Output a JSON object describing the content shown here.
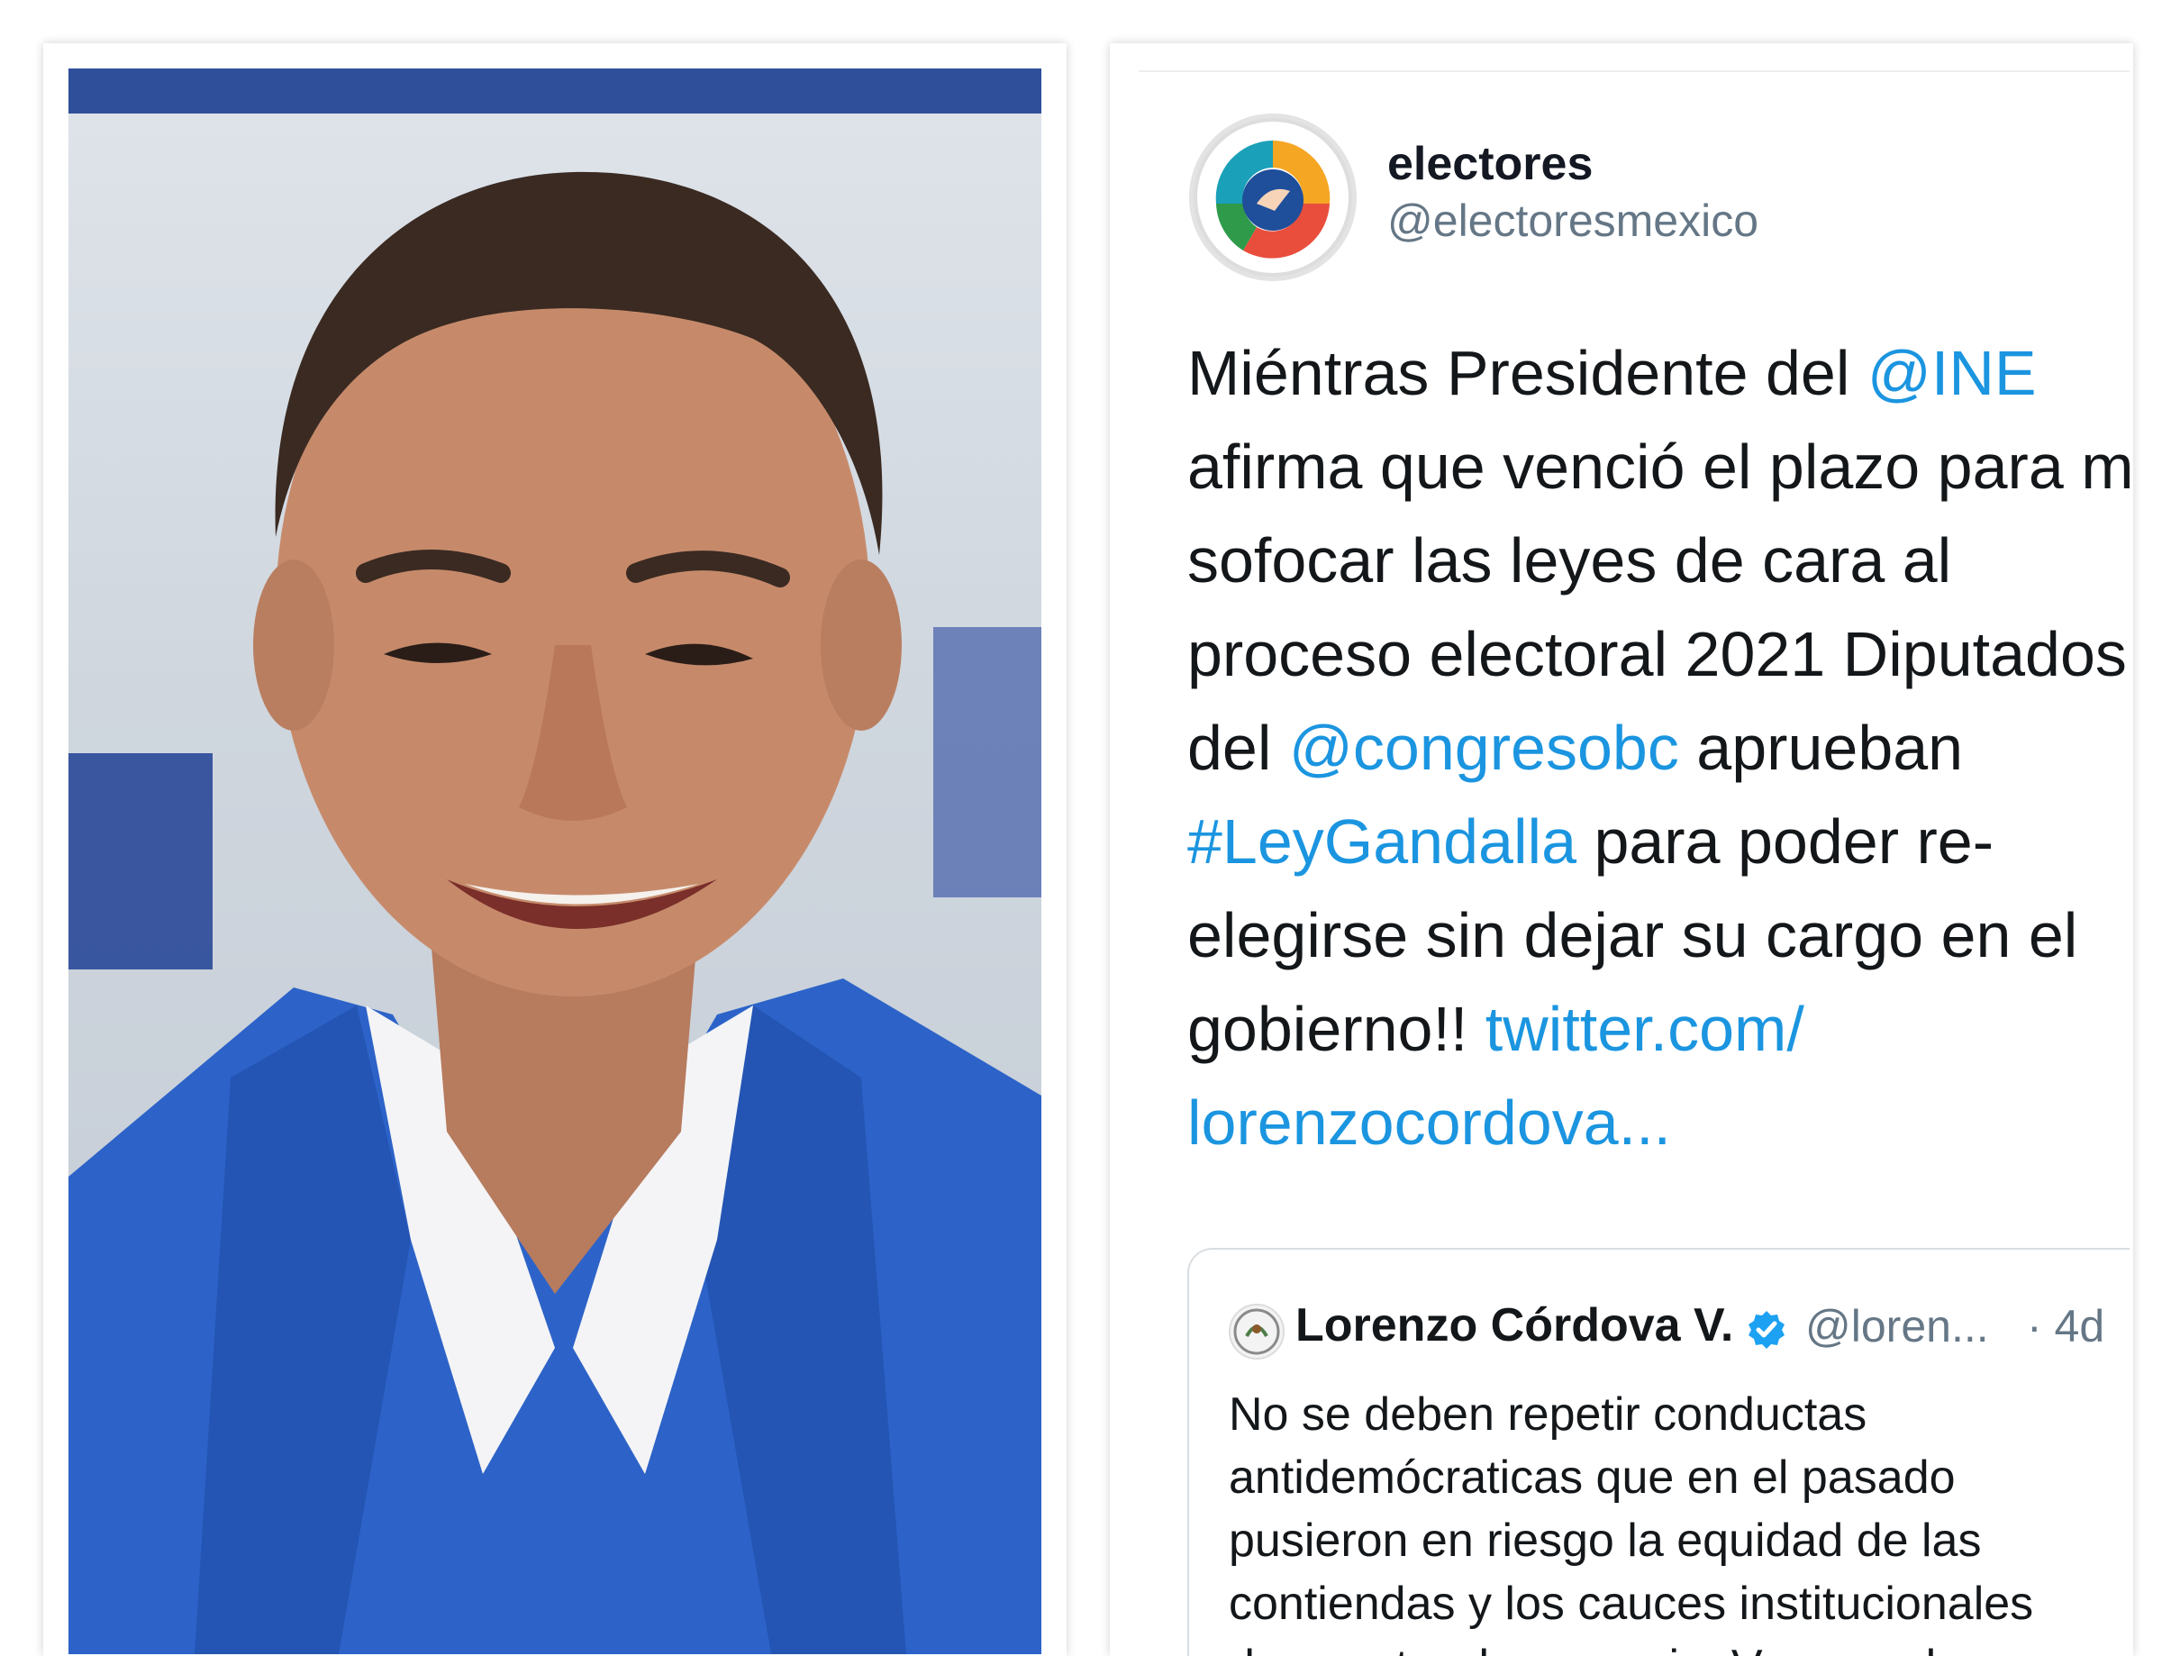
{
  "photo": {
    "description_icon": "portrait-photo"
  },
  "tweet": {
    "display_name": "electores",
    "handle": "@electoresmexico",
    "body": {
      "line1_a": "Miéntras Presidente del ",
      "line1_mention": "@INE",
      "line2": "afirma que venció el plazo para m",
      "line3": "sofocar las leyes de cara al",
      "line4": "proceso electoral 2021 Diputados",
      "line5_a": "del ",
      "line5_mention": "@congresobc",
      "line5_b": " aprueban",
      "line6_hashtag": "#LeyGandalla",
      "line6_b": " para poder re-",
      "line7": "elegirse sin dejar su cargo en el",
      "line8_a": "gobierno!!  ",
      "line8_link": "twitter.com/",
      "line9_link": "lorenzocordova..."
    },
    "colors": {
      "link": "#1b95e0",
      "text": "#14171a",
      "muted": "#657786"
    }
  },
  "quoted_tweet": {
    "display_name": "Lorenzo Córdova V.",
    "handle": "@loren...",
    "time": "· 4d",
    "lines": [
      "No se deben repetir conductas",
      "antidemócraticas que en el pasado",
      "pusieron en riesgo la equidad de las",
      "contiendas y los cauces institucionales",
      "de nuestra democracia. Vamos a la"
    ]
  }
}
